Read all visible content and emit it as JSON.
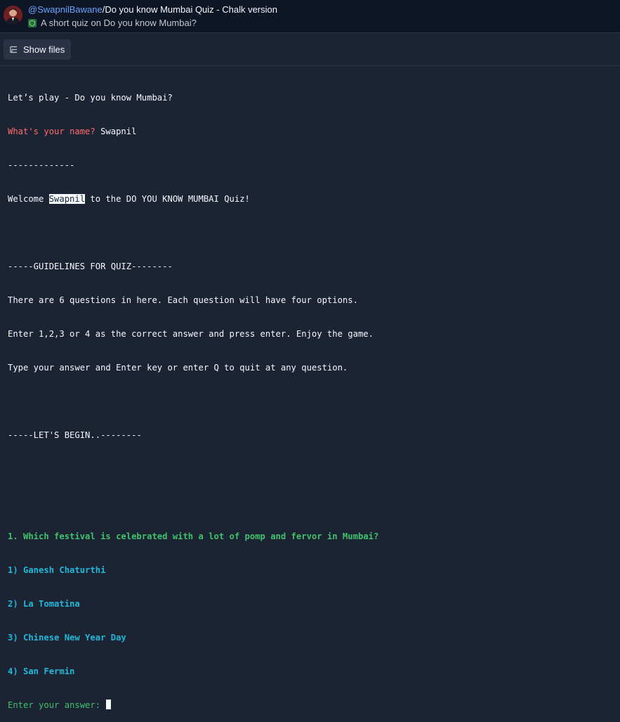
{
  "header": {
    "username": "@SwapnilBawane",
    "separator": "/",
    "repl_name": "Do you know Mumbai Quiz - Chalk version",
    "description": "A short quiz on Do you know Mumbai?"
  },
  "toolbar": {
    "show_files_label": "Show files"
  },
  "console": {
    "intro": "Let’s play - Do you know Mumbai?",
    "name_prompt": "What's your name? ",
    "name_value": "Swapnil",
    "divider": "-------------",
    "welcome_prefix": "Welcome ",
    "welcome_name": "Swapnil",
    "welcome_suffix": " to the DO YOU KNOW MUMBAI Quiz!",
    "guidelines_heading": "-----GUIDELINES FOR QUIZ--------",
    "guideline_1": "There are 6 questions in here. Each question will have four options.",
    "guideline_2": "Enter 1,2,3 or 4 as the correct answer and press enter. Enjoy the game.",
    "guideline_3": "Type your answer and Enter key or enter Q to quit at any question.",
    "begin_heading": "-----LET'S BEGIN..--------",
    "question": "1. Which festival is celebrated with a lot of pomp and fervor in Mumbai?",
    "options": [
      "1) Ganesh Chaturthi",
      "2) La Tomatina",
      "3) Chinese New Year Day",
      "4) San Fermin"
    ],
    "answer_prompt": "Enter your answer: "
  }
}
